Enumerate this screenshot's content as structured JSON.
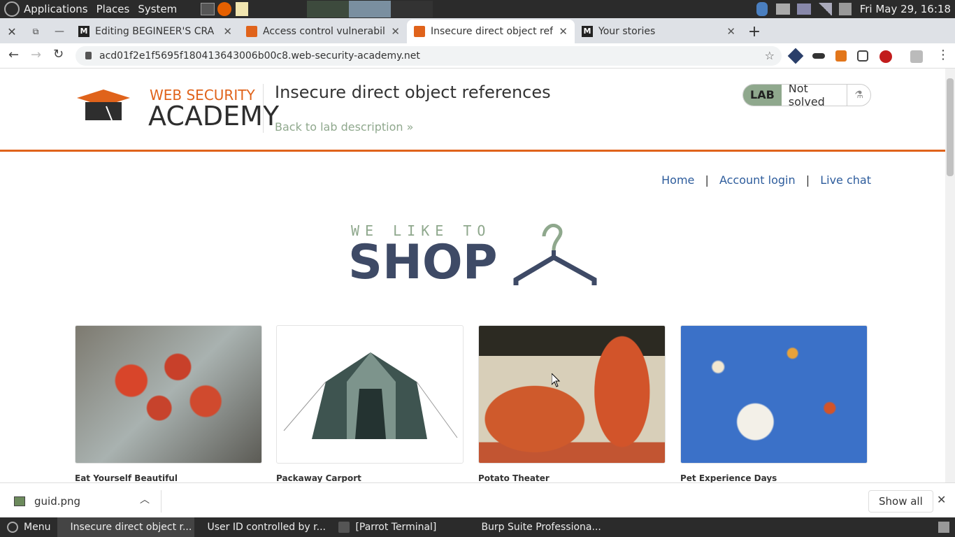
{
  "os_top": {
    "menus": [
      "Applications",
      "Places",
      "System"
    ],
    "clock": "Fri May 29, 16:18"
  },
  "browser": {
    "tabs": [
      {
        "title": "Editing BEGINEER'S CRA",
        "favicon": "medium-icon",
        "active": false
      },
      {
        "title": "Access control vulnerabili",
        "favicon": "portswigger-icon",
        "active": false
      },
      {
        "title": "Insecure direct object refe",
        "favicon": "portswigger-icon",
        "active": true
      },
      {
        "title": "Your stories",
        "favicon": "medium-icon",
        "active": false
      }
    ],
    "url": "acd01f2e1f5695f180413643006b00c8.web-security-academy.net"
  },
  "lab": {
    "logo_top": "WEB SECURITY",
    "logo_bottom": "ACADEMY",
    "title": "Insecure direct object references",
    "back_link": "Back to lab description",
    "badge_label": "LAB",
    "status": "Not solved"
  },
  "shop": {
    "nav": [
      "Home",
      "Account login",
      "Live chat"
    ],
    "logo_small": "WE LIKE TO",
    "logo_big": "SHOP",
    "products": [
      {
        "name": "Eat Yourself Beautiful"
      },
      {
        "name": "Packaway Carport"
      },
      {
        "name": "Potato Theater"
      },
      {
        "name": "Pet Experience Days"
      }
    ]
  },
  "downloads": {
    "file": "guid.png",
    "show_all": "Show all"
  },
  "taskbar": {
    "menu": "Menu",
    "items": [
      {
        "label": "Insecure direct object r...",
        "icon": "chrome-icon"
      },
      {
        "label": "User ID controlled by r...",
        "icon": "firefox-icon"
      },
      {
        "label": "[Parrot Terminal]",
        "icon": "terminal-icon"
      },
      {
        "label": "Burp Suite Professiona...",
        "icon": "burp-icon"
      }
    ]
  },
  "colors": {
    "accent": "#e0631b",
    "lab_green": "#8fa88d",
    "link": "#2d5c9c"
  }
}
